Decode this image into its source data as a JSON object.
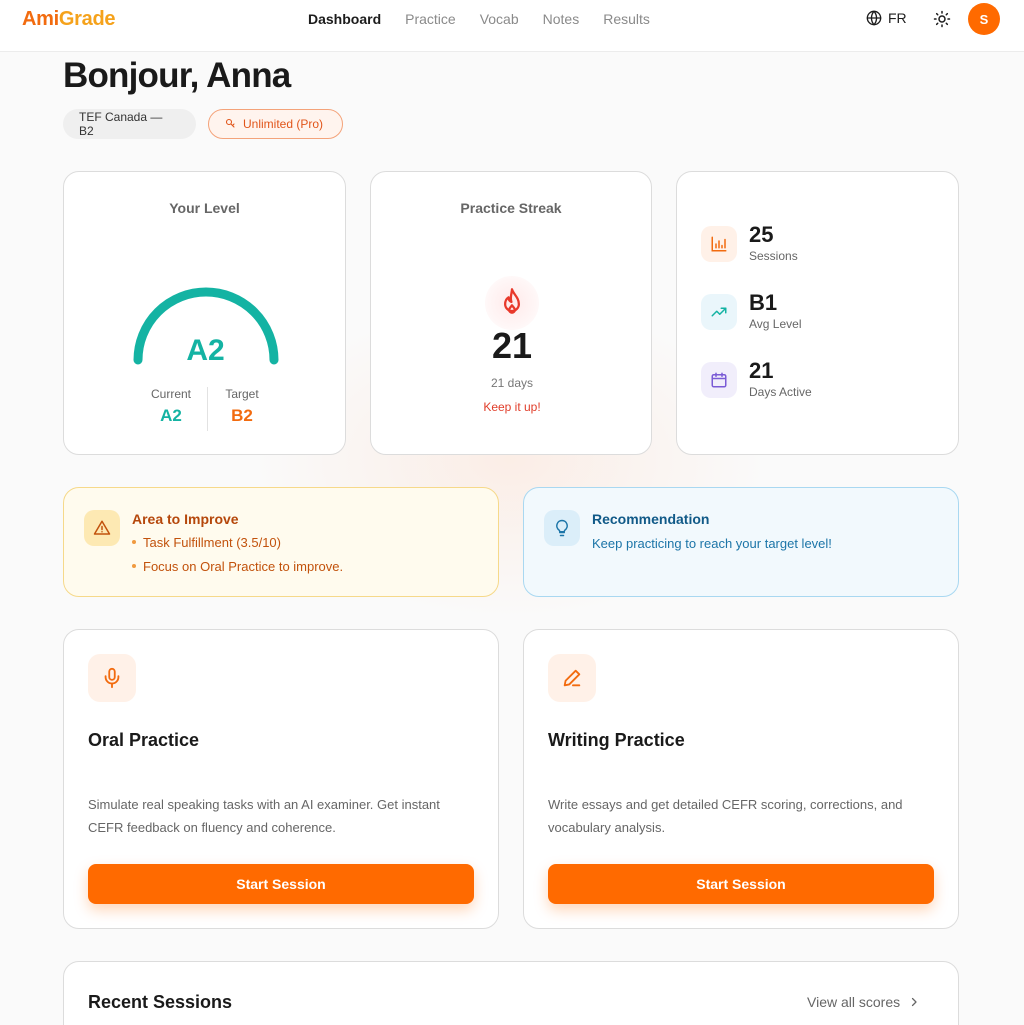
{
  "app": {
    "logo_part1": "Ami",
    "logo_part2": "Grade"
  },
  "nav": {
    "items": [
      "Dashboard",
      "Practice",
      "Vocab",
      "Notes",
      "Results"
    ],
    "active": "Dashboard"
  },
  "header": {
    "language": "FR",
    "avatar_initial": "S"
  },
  "greeting": "Bonjour, Anna",
  "pills": {
    "exam": "TEF Canada — B2",
    "plan": "Unlimited (Pro)"
  },
  "level_card": {
    "title": "Your Level",
    "level": "A2",
    "current_label": "Current",
    "current": "A2",
    "target_label": "Target",
    "target": "B2",
    "gauge_fill": 0.5
  },
  "streak_card": {
    "title": "Practice Streak",
    "count": "21",
    "days_text": "21 days",
    "encouragement": "Keep it up!"
  },
  "stats": [
    {
      "value": "25",
      "label": "Sessions",
      "icon": "bar-chart-icon"
    },
    {
      "value": "B1",
      "label": "Avg Level",
      "icon": "trending-up-icon"
    },
    {
      "value": "21",
      "label": "Days Active",
      "icon": "calendar-icon"
    }
  ],
  "improve": {
    "title": "Area to Improve",
    "items": [
      "Task Fulfillment (3.5/10)",
      "Focus on Oral Practice to improve."
    ]
  },
  "recommendation": {
    "title": "Recommendation",
    "text": "Keep practicing to reach your target level!"
  },
  "practice": {
    "oral": {
      "title": "Oral Practice",
      "description": "Simulate real speaking tasks with an AI examiner. Get instant CEFR feedback on fluency and coherence.",
      "button": "Start Session"
    },
    "writing": {
      "title": "Writing Practice",
      "description": "Write essays and get detailed CEFR scoring, corrections, and vocabulary analysis.",
      "button": "Start Session"
    }
  },
  "recent": {
    "title": "Recent Sessions",
    "link": "View all scores"
  },
  "colors": {
    "accent": "#ff6a00",
    "teal": "#14b3a3",
    "target_orange": "#f26b0f"
  }
}
